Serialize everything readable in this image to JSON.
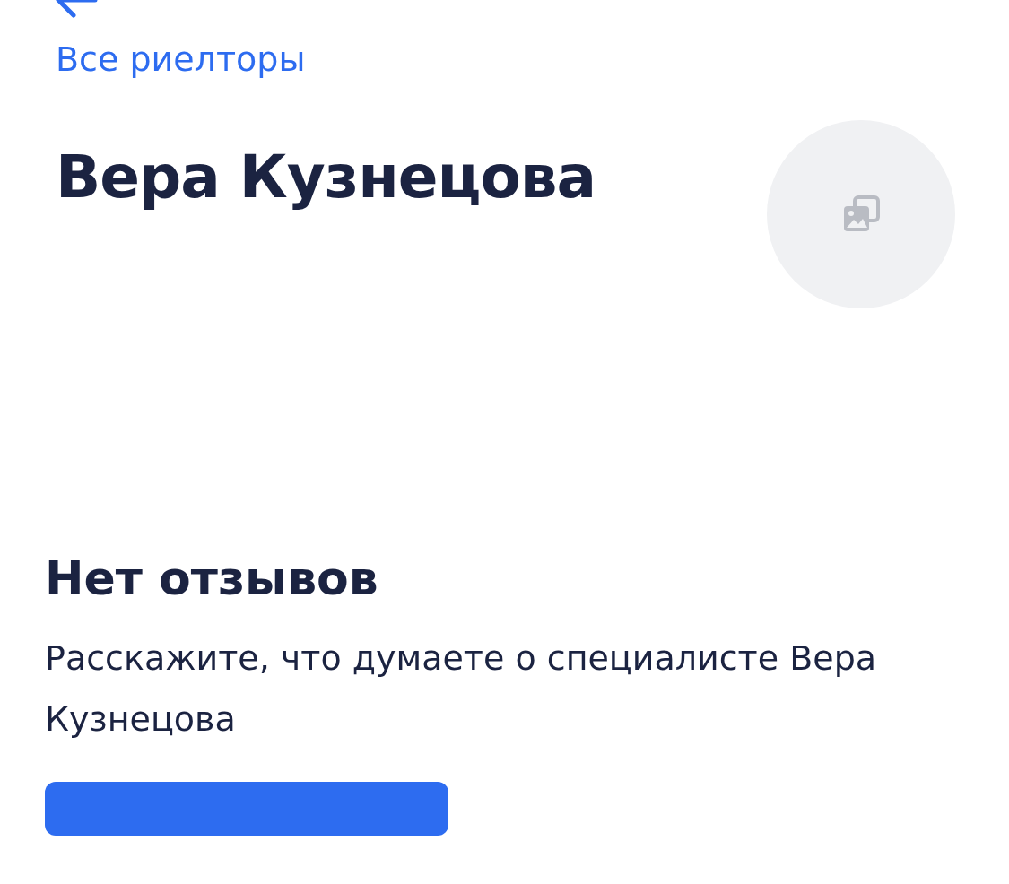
{
  "back_link": {
    "label": "Все риелторы"
  },
  "profile": {
    "name": "Вера Кузнецова",
    "avatar": {
      "kind": "placeholder"
    }
  },
  "reviews": {
    "title": "Нет отзывов",
    "text": "Расскажите, что думаете о специалисте Вера Кузнецова"
  }
}
